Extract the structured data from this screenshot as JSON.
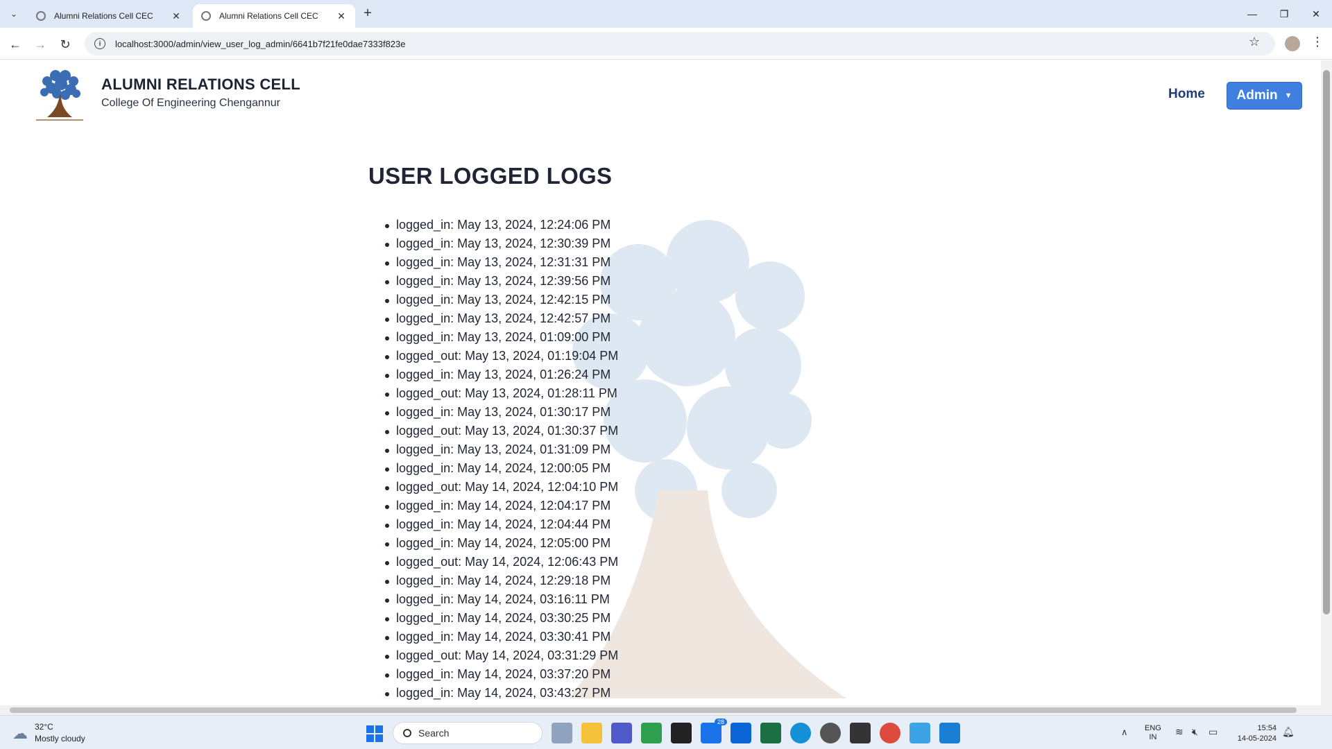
{
  "browser": {
    "tabs": [
      {
        "title": "Alumni Relations Cell CEC",
        "active": false
      },
      {
        "title": "Alumni Relations Cell CEC",
        "active": true
      }
    ],
    "url": "localhost:3000/admin/view_user_log_admin/6641b7f21fe0dae7333f823e"
  },
  "site": {
    "title": "ALUMNI RELATIONS CELL",
    "subtitle": "College Of Engineering Chengannur",
    "nav": {
      "home": "Home",
      "admin": "Admin"
    }
  },
  "page": {
    "heading": "USER LOGGED LOGS",
    "logs": [
      "logged_in: May 13, 2024, 12:24:06 PM",
      "logged_in: May 13, 2024, 12:30:39 PM",
      "logged_in: May 13, 2024, 12:31:31 PM",
      "logged_in: May 13, 2024, 12:39:56 PM",
      "logged_in: May 13, 2024, 12:42:15 PM",
      "logged_in: May 13, 2024, 12:42:57 PM",
      "logged_in: May 13, 2024, 01:09:00 PM",
      "logged_out: May 13, 2024, 01:19:04 PM",
      "logged_in: May 13, 2024, 01:26:24 PM",
      "logged_out: May 13, 2024, 01:28:11 PM",
      "logged_in: May 13, 2024, 01:30:17 PM",
      "logged_out: May 13, 2024, 01:30:37 PM",
      "logged_in: May 13, 2024, 01:31:09 PM",
      "logged_in: May 14, 2024, 12:00:05 PM",
      "logged_out: May 14, 2024, 12:04:10 PM",
      "logged_in: May 14, 2024, 12:04:17 PM",
      "logged_in: May 14, 2024, 12:04:44 PM",
      "logged_in: May 14, 2024, 12:05:00 PM",
      "logged_out: May 14, 2024, 12:06:43 PM",
      "logged_in: May 14, 2024, 12:29:18 PM",
      "logged_in: May 14, 2024, 03:16:11 PM",
      "logged_in: May 14, 2024, 03:30:25 PM",
      "logged_in: May 14, 2024, 03:30:41 PM",
      "logged_out: May 14, 2024, 03:31:29 PM",
      "logged_in: May 14, 2024, 03:37:20 PM",
      "logged_in: May 14, 2024, 03:43:27 PM"
    ]
  },
  "taskbar": {
    "weather_temp": "32°C",
    "weather_desc": "Mostly cloudy",
    "search_label": "Search",
    "mail_badge": "28",
    "lang_top": "ENG",
    "lang_bottom": "IN",
    "time": "15:54",
    "date": "14-05-2024"
  },
  "colors": {
    "admin_button": "#3f7fe0",
    "home_link": "#1f3c74",
    "taskbar": "#e8eef7"
  }
}
